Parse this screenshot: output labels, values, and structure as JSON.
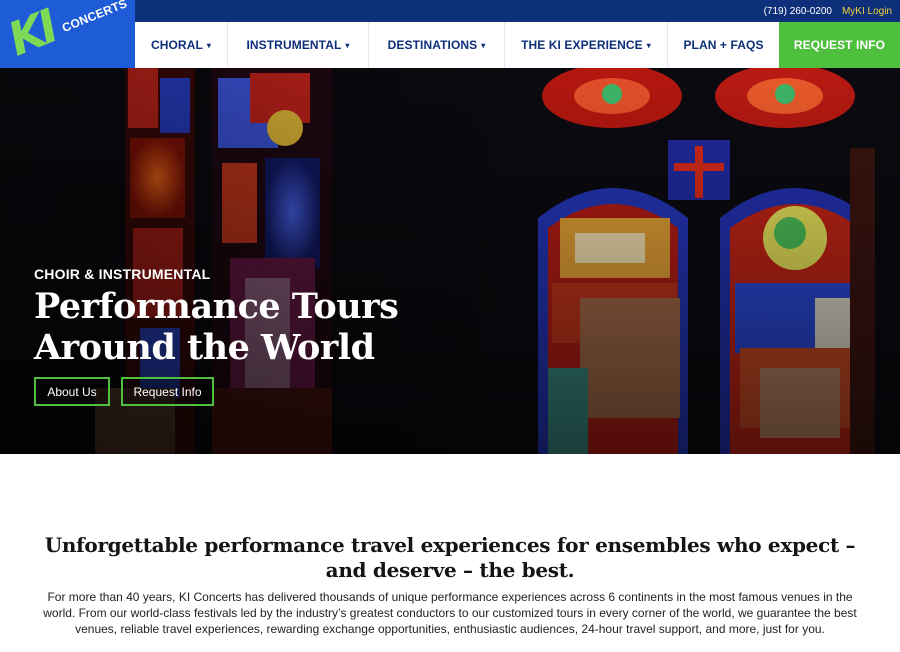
{
  "logo": {
    "main": "KI",
    "sub": "CONCERTS"
  },
  "topbar": {
    "phone": "(719) 260-0200",
    "login": "MyKI Login"
  },
  "nav": {
    "items": [
      {
        "label": "CHORAL",
        "caret": "▾"
      },
      {
        "label": "INSTRUMENTAL",
        "caret": "▾"
      },
      {
        "label": "DESTINATIONS",
        "caret": "▾"
      },
      {
        "label": "THE KI EXPERIENCE",
        "caret": "▾"
      },
      {
        "label": "PLAN + FAQS"
      }
    ],
    "cta": "REQUEST INFO"
  },
  "hero": {
    "eyebrow": "CHOIR & INSTRUMENTAL",
    "title_line1": "Performance Tours",
    "title_line2": "Around the World",
    "buttons": {
      "about": "About Us",
      "request": "Request Info"
    }
  },
  "intro": {
    "heading": "Unforgettable performance travel experiences for ensembles who expect – and deserve – the best.",
    "body": "For more than 40 years, KI Concerts has delivered thousands of unique performance experiences across 6 continents in the most famous venues in the world. From our world-class festivals led by the industry’s greatest conductors to our customized tours in every corner of the world, we guarantee the best venues, reliable travel experiences, rewarding exchange opportunities, enthusiastic audiences, 24-hour travel support, and more, just for you."
  },
  "colors": {
    "brand_blue": "#1e5bd6",
    "navy": "#0e2f7a",
    "accent_green": "#4fbf3e",
    "login_yellow": "#f2d13a"
  }
}
